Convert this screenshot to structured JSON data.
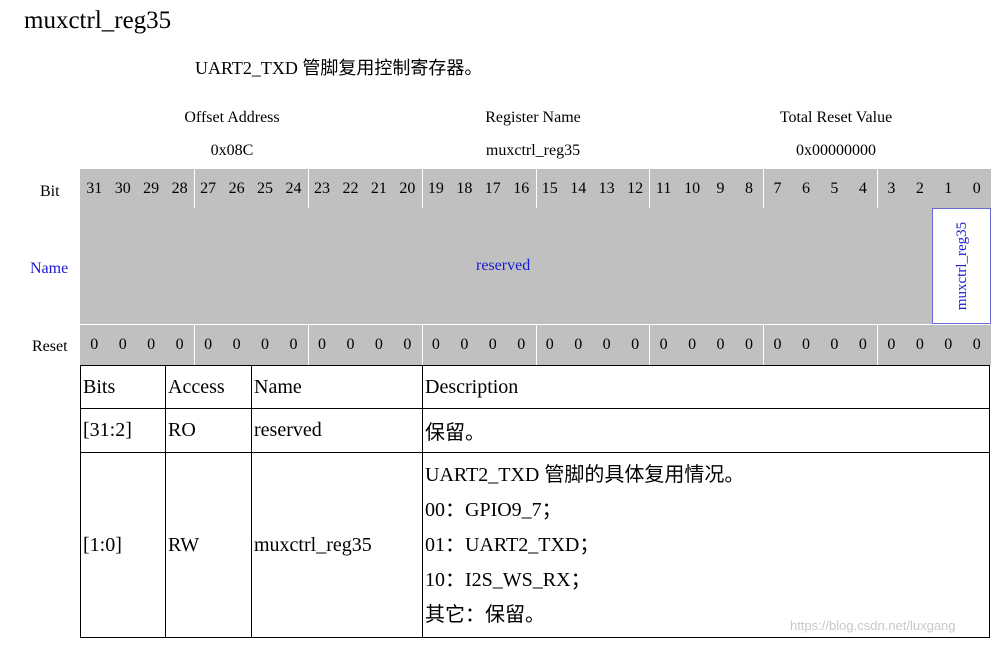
{
  "register": {
    "title": "muxctrl_reg35",
    "subtitle": "UART2_TXD 管脚复用控制寄存器。"
  },
  "header": {
    "offset_label": "Offset Address",
    "offset_value": "0x08C",
    "name_label": "Register Name",
    "name_value": "muxctrl_reg35",
    "reset_label": "Total Reset Value",
    "reset_value": "0x00000000"
  },
  "bitmap": {
    "bit_label": "Bit",
    "name_label": "Name",
    "reset_label": "Reset",
    "bits": [
      "31",
      "30",
      "29",
      "28",
      "27",
      "26",
      "25",
      "24",
      "23",
      "22",
      "21",
      "20",
      "19",
      "18",
      "17",
      "16",
      "15",
      "14",
      "13",
      "12",
      "11",
      "10",
      "9",
      "8",
      "7",
      "6",
      "5",
      "4",
      "3",
      "2",
      "1",
      "0"
    ],
    "resets": [
      "0",
      "0",
      "0",
      "0",
      "0",
      "0",
      "0",
      "0",
      "0",
      "0",
      "0",
      "0",
      "0",
      "0",
      "0",
      "0",
      "0",
      "0",
      "0",
      "0",
      "0",
      "0",
      "0",
      "0",
      "0",
      "0",
      "0",
      "0",
      "0",
      "0",
      "0",
      "0"
    ],
    "field_reserved": "reserved",
    "field_mux": "muxctrl_reg35",
    "name_color": "#1a1ad0",
    "cell_bg": "#c0c0c0"
  },
  "fields_table": {
    "headers": [
      "Bits",
      "Access",
      "Name",
      "Description"
    ],
    "rows": [
      {
        "bits": "[31:2]",
        "access": "RO",
        "name": "reserved",
        "description": [
          "保留。"
        ]
      },
      {
        "bits": "[1:0]",
        "access": "RW",
        "name": "muxctrl_reg35",
        "description": [
          "UART2_TXD 管脚的具体复用情况。",
          "00：GPIO9_7；",
          "01：UART2_TXD；",
          "10：I2S_WS_RX；",
          "其它：保留。"
        ]
      }
    ]
  },
  "watermark": "https://blog.csdn.net/luxgang"
}
